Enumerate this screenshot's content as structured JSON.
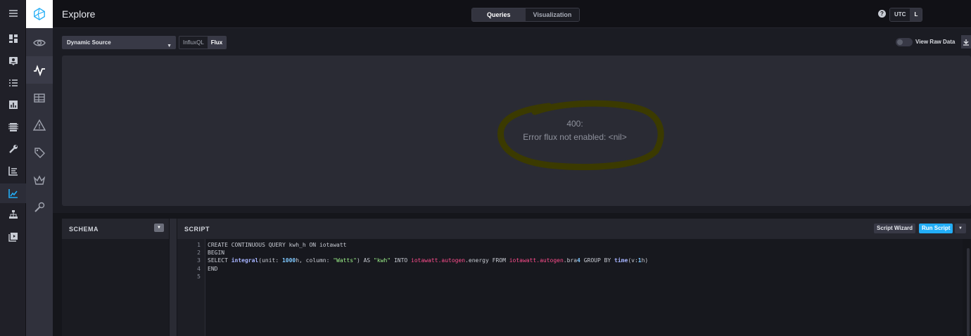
{
  "header": {
    "title": "Explore",
    "tabs": [
      "Queries",
      "Visualization"
    ],
    "help_icon": "?",
    "timezone": [
      "UTC",
      "L"
    ]
  },
  "toolbar": {
    "source": "Dynamic Source",
    "query_types": [
      "InfluxQL",
      "Flux"
    ],
    "raw_label": "View Raw Data"
  },
  "error": {
    "code": "400:",
    "message": "Error flux not enabled: <nil>"
  },
  "schema": {
    "title": "SCHEMA"
  },
  "script": {
    "title": "SCRIPT",
    "wizard": "Script Wizard",
    "run": "Run Script",
    "line_numbers": [
      "1",
      "2",
      "3",
      "4",
      "5"
    ],
    "lines": [
      "CREATE CONTINUOUS QUERY kwh_h ON iotawatt",
      "BEGIN",
      "SELECT integral(unit: 1000h, column: \"Watts\") AS \"kwh\" INTO iotawatt.autogen.energy FROM iotawatt.autogen.bra4 GROUP BY time(v:1h)",
      "END",
      ""
    ]
  },
  "colors": {
    "accent": "#22adf6",
    "highlight": "#3b3a00"
  }
}
